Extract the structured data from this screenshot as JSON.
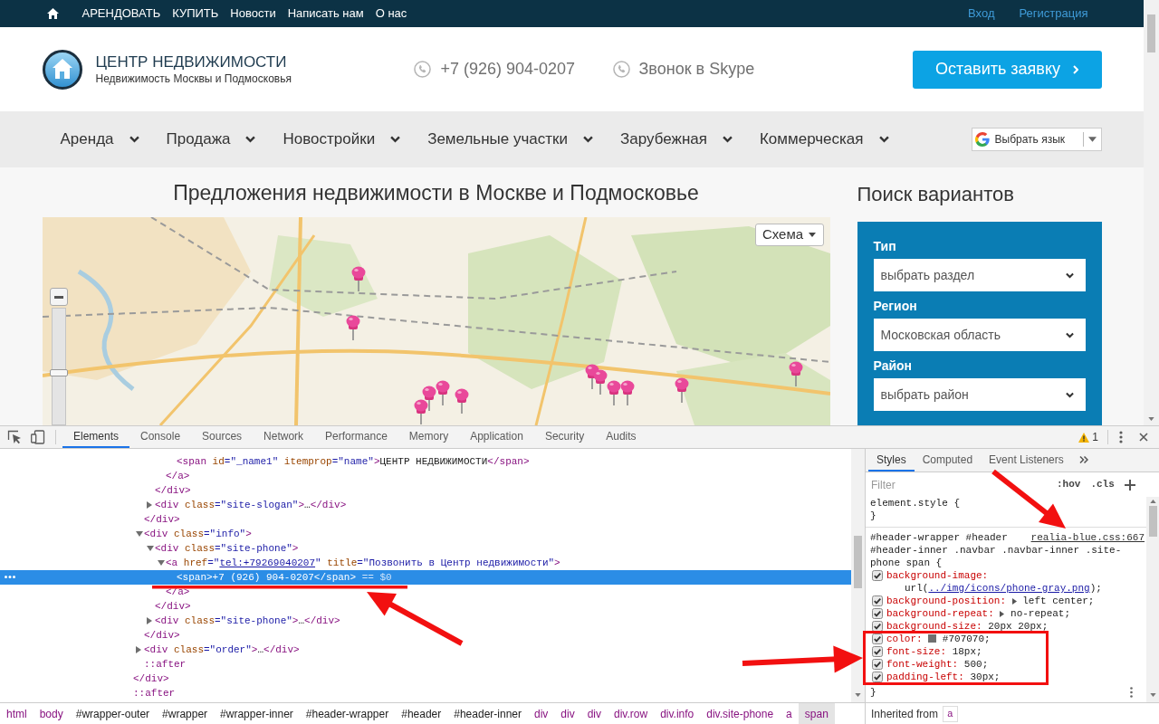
{
  "top_bar": {
    "links": [
      "АРЕНДОВАТЬ",
      "КУПИТЬ",
      "Новости",
      "Написать нам",
      "О нас"
    ],
    "account_links": [
      "Вход",
      "Регистрация"
    ]
  },
  "header": {
    "logo_title": "ЦЕНТР НЕДВИЖИМОСТИ",
    "logo_slogan": "Недвижимость Москвы и Подмосковья",
    "phone": "+7 (926) 904-0207",
    "skype": "Звонок в Skype",
    "request_button": "Оставить заявку"
  },
  "nav": {
    "items": [
      "Аренда",
      "Продажа",
      "Новостройки",
      "Земельные участки",
      "Зарубежная",
      "Коммерческая"
    ],
    "language_select": "Выбрать язык"
  },
  "listings": {
    "title": "Предложения недвижимости в Москве и Подмосковье",
    "map": {
      "layer_button": "Схема",
      "zoom_slider": {
        "level": 0.45
      }
    }
  },
  "search": {
    "title": "Поиск вариантов",
    "fields": [
      {
        "label": "Тип",
        "value": "выбрать раздел"
      },
      {
        "label": "Регион",
        "value": "Московская область"
      },
      {
        "label": "Район",
        "value": "выбрать район"
      }
    ]
  },
  "devtools": {
    "tabs": [
      {
        "label": "Elements",
        "selected": true
      },
      {
        "label": "Console",
        "selected": false
      },
      {
        "label": "Sources",
        "selected": false
      },
      {
        "label": "Network",
        "selected": false
      },
      {
        "label": "Performance",
        "selected": false
      },
      {
        "label": "Memory",
        "selected": false
      },
      {
        "label": "Application",
        "selected": false
      },
      {
        "label": "Security",
        "selected": false
      },
      {
        "label": "Audits",
        "selected": false
      }
    ],
    "warning_count": "1",
    "dom_tree": [
      {
        "kind": "cut",
        "selected": false,
        "children": [
          {
            "kind": "cut",
            "selected": false,
            "children": [
              {
                "kind": "cut",
                "selected": false,
                "children": [
                  {
                    "kind": "cut",
                    "selected": false,
                    "children": [
                      {
                        "kind": "leaf",
                        "selected": false,
                        "open": [
                          {
                            "kind": "tag",
                            "text": "<span"
                          },
                          {
                            "kind": "attr",
                            "text": " id"
                          },
                          {
                            "kind": "value",
                            "text": "=\"_name1\""
                          },
                          {
                            "kind": "attr",
                            "text": " itemprop"
                          },
                          {
                            "kind": "value",
                            "text": "=\"name\""
                          },
                          {
                            "kind": "tag",
                            "text": ">"
                          },
                          {
                            "kind": "text",
                            "text": "ЦЕНТР НЕДВИЖИМОСТИ"
                          },
                          {
                            "kind": "tag",
                            "text": "</span>"
                          }
                        ]
                      }
                    ],
                    "close": [
                      {
                        "kind": "tag",
                        "text": "</a>"
                      }
                    ]
                  }
                ],
                "close": [
                  {
                    "kind": "tag",
                    "text": "</div>"
                  }
                ]
              },
              {
                "kind": "branch",
                "expanded": false,
                "selected": false,
                "open": [
                  {
                    "kind": "tag",
                    "text": "<div"
                  },
                  {
                    "kind": "attr",
                    "text": " class"
                  },
                  {
                    "kind": "value",
                    "text": "=\"site-slogan\""
                  },
                  {
                    "kind": "tag",
                    "text": ">"
                  },
                  {
                    "kind": "text",
                    "text": "…"
                  },
                  {
                    "kind": "tag",
                    "text": "</div>"
                  }
                ]
              }
            ],
            "close": [
              {
                "kind": "tag",
                "text": "</div>"
              }
            ]
          },
          {
            "kind": "branch",
            "expanded": true,
            "selected": false,
            "open": [
              {
                "kind": "tag",
                "text": "<div"
              },
              {
                "kind": "attr",
                "text": " class"
              },
              {
                "kind": "value",
                "text": "=\"info\""
              },
              {
                "kind": "tag",
                "text": ">"
              }
            ],
            "children": [
              {
                "kind": "branch",
                "expanded": true,
                "selected": false,
                "open": [
                  {
                    "kind": "tag",
                    "text": "<div"
                  },
                  {
                    "kind": "attr",
                    "text": " class"
                  },
                  {
                    "kind": "value",
                    "text": "=\"site-phone\""
                  },
                  {
                    "kind": "tag",
                    "text": ">"
                  }
                ],
                "children": [
                  {
                    "kind": "branch",
                    "expanded": true,
                    "selected": false,
                    "open": [
                      {
                        "kind": "tag",
                        "text": "<a"
                      },
                      {
                        "kind": "attr",
                        "text": " href"
                      },
                      {
                        "kind": "value",
                        "text": "=\""
                      },
                      {
                        "kind": "link",
                        "text": "tel:+79269040207"
                      },
                      {
                        "kind": "value",
                        "text": "\""
                      },
                      {
                        "kind": "attr",
                        "text": " title"
                      },
                      {
                        "kind": "value",
                        "text": "=\"Позвонить в Центр недвижимости\""
                      },
                      {
                        "kind": "tag",
                        "text": ">"
                      }
                    ],
                    "children": [
                      {
                        "kind": "leaf",
                        "selected": true,
                        "open": [
                          {
                            "kind": "tag",
                            "text": "<span>"
                          },
                          {
                            "kind": "text",
                            "text": "+7 (926) 904-0207"
                          },
                          {
                            "kind": "tag",
                            "text": "</span>"
                          },
                          {
                            "kind": "hint",
                            "text": " == $0"
                          }
                        ]
                      }
                    ],
                    "close": [
                      {
                        "kind": "tag",
                        "text": "</a>"
                      }
                    ]
                  }
                ],
                "close": [
                  {
                    "kind": "tag",
                    "text": "</div>"
                  }
                ]
              },
              {
                "kind": "branch",
                "expanded": false,
                "selected": false,
                "open": [
                  {
                    "kind": "tag",
                    "text": "<div"
                  },
                  {
                    "kind": "attr",
                    "text": " class"
                  },
                  {
                    "kind": "value",
                    "text": "=\"site-phone\""
                  },
                  {
                    "kind": "tag",
                    "text": ">"
                  },
                  {
                    "kind": "text",
                    "text": "…"
                  },
                  {
                    "kind": "tag",
                    "text": "</div>"
                  }
                ]
              }
            ],
            "close": [
              {
                "kind": "tag",
                "text": "</div>"
              }
            ]
          },
          {
            "kind": "branch",
            "expanded": false,
            "selected": false,
            "open": [
              {
                "kind": "tag",
                "text": "<div"
              },
              {
                "kind": "attr",
                "text": " class"
              },
              {
                "kind": "value",
                "text": "=\"order\""
              },
              {
                "kind": "tag",
                "text": ">"
              },
              {
                "kind": "text",
                "text": "…"
              },
              {
                "kind": "tag",
                "text": "</div>"
              }
            ]
          },
          {
            "kind": "leaf",
            "selected": false,
            "open": [
              {
                "kind": "pseudo",
                "text": "::after"
              }
            ]
          }
        ],
        "close": [
          {
            "kind": "tag",
            "text": "</div>"
          }
        ]
      },
      {
        "kind": "leaf",
        "selected": false,
        "open": [
          {
            "kind": "pseudo",
            "text": "::after"
          }
        ]
      }
    ],
    "breadcrumbs": [
      {
        "kind": "tag",
        "label": "html",
        "selected": false
      },
      {
        "kind": "tag",
        "label": "body",
        "selected": false
      },
      {
        "kind": "id",
        "label": "#wrapper-outer",
        "selected": false
      },
      {
        "kind": "id",
        "label": "#wrapper",
        "selected": false
      },
      {
        "kind": "id",
        "label": "#wrapper-inner",
        "selected": false
      },
      {
        "kind": "id",
        "label": "#header-wrapper",
        "selected": false
      },
      {
        "kind": "id",
        "label": "#header",
        "selected": false
      },
      {
        "kind": "id",
        "label": "#header-inner",
        "selected": false
      },
      {
        "kind": "tag",
        "label": "div",
        "selected": false
      },
      {
        "kind": "tag",
        "label": "div",
        "selected": false
      },
      {
        "kind": "tag",
        "label": "div",
        "selected": false
      },
      {
        "kind": "tag",
        "label": "div.row",
        "selected": false
      },
      {
        "kind": "tag",
        "label": "div.info",
        "selected": false
      },
      {
        "kind": "tag",
        "label": "div.site-phone",
        "selected": false
      },
      {
        "kind": "tag",
        "label": "a",
        "selected": false
      },
      {
        "kind": "tag",
        "label": "span",
        "selected": true
      }
    ],
    "styles_tabs": [
      {
        "label": "Styles",
        "selected": true
      },
      {
        "label": "Computed",
        "selected": false
      },
      {
        "label": "Event Listeners",
        "selected": false
      }
    ],
    "filter": {
      "placeholder": "Filter"
    },
    "filter_buttons": [
      ":hov",
      ".cls"
    ],
    "rules": [
      {
        "selector_lines": [
          "element.style {"
        ],
        "close": "}"
      },
      {
        "selector_lines": [
          "#header-wrapper #header",
          "#header-inner .navbar .navbar-inner .site-",
          "phone span {"
        ],
        "source": "realia-blue.css:667",
        "declarations": [
          {
            "kind": "url",
            "property": "background-image:",
            "before": "url(",
            "link": "../img/icons/phone-gray.png",
            "after": ");",
            "checked": true
          },
          {
            "kind": "shorthand",
            "property": "background-position:",
            "value": "left center;",
            "checked": true
          },
          {
            "kind": "shorthand",
            "property": "background-repeat:",
            "value": "no-repeat;",
            "checked": true
          },
          {
            "kind": "plain",
            "property": "background-size:",
            "value": "20px 20px;",
            "checked": true
          },
          {
            "kind": "color",
            "property": "color:",
            "color": "#707070",
            "value": "#707070;",
            "checked": true
          },
          {
            "kind": "plain",
            "property": "font-size:",
            "value": "18px;",
            "checked": true
          },
          {
            "kind": "plain",
            "property": "font-weight:",
            "value": "500;",
            "checked": true
          },
          {
            "kind": "plain",
            "property": "padding-left:",
            "value": "30px;",
            "checked": true
          }
        ],
        "close": "}"
      }
    ],
    "inherited": {
      "label": "Inherited from",
      "tag": "a"
    }
  }
}
